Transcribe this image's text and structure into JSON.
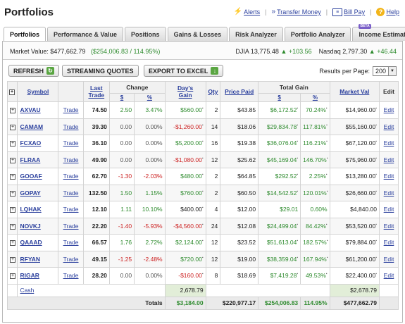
{
  "page_title": "Portfolios",
  "top_links": {
    "alerts": "Alerts",
    "transfer": "Transfer Money",
    "billpay": "Bill Pay",
    "help": "Help"
  },
  "tabs": [
    {
      "label": "Portfolios",
      "active": true
    },
    {
      "label": "Performance & Value",
      "active": false
    },
    {
      "label": "Positions",
      "active": false
    },
    {
      "label": "Gains & Losses",
      "active": false
    },
    {
      "label": "Risk Analyzer",
      "active": false
    },
    {
      "label": "Portfolio Analyzer",
      "active": false
    },
    {
      "label": "Income Estimator",
      "active": false,
      "badge": "BETA"
    }
  ],
  "summary": {
    "market_value_label": "Market Value:",
    "market_value": "$477,662.79",
    "gain_text": "($254,006.83 / 114.95%)",
    "djia_label": "DJIA",
    "djia_value": "13,775.48",
    "djia_change": "+103.56",
    "nasdaq_label": "Nasdaq",
    "nasdaq_value": "2,797.30",
    "nasdaq_change": "+46.44"
  },
  "toolbar": {
    "refresh": "REFRESH",
    "streaming": "STREAMING QUOTES",
    "export": "EXPORT TO EXCEL",
    "results_label": "Results per Page:",
    "results_value": "200"
  },
  "columns": {
    "symbol": "Symbol",
    "last_trade_1": "Last",
    "last_trade_2": "Trade",
    "change": "Change",
    "change_dollar": "$",
    "change_pct": "%",
    "days_gain_1": "Day's",
    "days_gain_2": "Gain",
    "qty": "Qty",
    "price_paid": "Price Paid",
    "total_gain": "Total Gain",
    "tg_dollar": "$",
    "tg_pct": "%",
    "market_val": "Market Val",
    "edit": "Edit"
  },
  "rows": [
    {
      "symbol": "AXVAU",
      "trade": "Trade",
      "last": "74.50",
      "chg": "2.50",
      "chg_pct": "3.47%",
      "day_gain": "$560.00",
      "qty": "2",
      "paid": "$43.85",
      "tg": "$6,172.52",
      "tg_pct": "70.24%",
      "mval": "$14,960.00",
      "edit": "Edit",
      "dir": "pos",
      "tgdir": "pos"
    },
    {
      "symbol": "CAMAM",
      "trade": "Trade",
      "last": "39.30",
      "chg": "0.00",
      "chg_pct": "0.00%",
      "day_gain": "-$1,260.00",
      "qty": "14",
      "paid": "$18.06",
      "tg": "$29,834.78",
      "tg_pct": "117.81%",
      "mval": "$55,160.00",
      "edit": "Edit",
      "dir": "flat",
      "dgdir": "neg",
      "tgdir": "pos"
    },
    {
      "symbol": "FCXAO",
      "trade": "Trade",
      "last": "36.10",
      "chg": "0.00",
      "chg_pct": "0.00%",
      "day_gain": "$5,200.00",
      "qty": "16",
      "paid": "$19.38",
      "tg": "$36,076.04",
      "tg_pct": "116.21%",
      "mval": "$67,120.00",
      "edit": "Edit",
      "dir": "flat",
      "dgdir": "pos",
      "tgdir": "pos"
    },
    {
      "symbol": "FLRAA",
      "trade": "Trade",
      "last": "49.90",
      "chg": "0.00",
      "chg_pct": "0.00%",
      "day_gain": "-$1,080.00",
      "qty": "12",
      "paid": "$25.62",
      "tg": "$45,169.04",
      "tg_pct": "146.70%",
      "mval": "$75,960.00",
      "edit": "Edit",
      "dir": "flat",
      "dgdir": "neg",
      "tgdir": "pos"
    },
    {
      "symbol": "GOOAF",
      "trade": "Trade",
      "last": "62.70",
      "chg": "-1.30",
      "chg_pct": "-2.03%",
      "day_gain": "$480.00",
      "qty": "2",
      "paid": "$64.85",
      "tg": "$292.52",
      "tg_pct": "2.25%",
      "mval": "$13,280.00",
      "edit": "Edit",
      "dir": "neg",
      "dgdir": "pos",
      "tgdir": "pos"
    },
    {
      "symbol": "GOPAY",
      "trade": "Trade",
      "last": "132.50",
      "chg": "1.50",
      "chg_pct": "1.15%",
      "day_gain": "$760.00",
      "qty": "2",
      "paid": "$60.50",
      "tg": "$14,542.52",
      "tg_pct": "120.01%",
      "mval": "$26,660.00",
      "edit": "Edit",
      "dir": "pos",
      "dgdir": "pos",
      "tgdir": "pos"
    },
    {
      "symbol": "LQHAK",
      "trade": "Trade",
      "last": "12.10",
      "chg": "1.11",
      "chg_pct": "10.10%",
      "day_gain": "$400.00",
      "qty": "4",
      "paid": "$12.00",
      "tg": "$29.01",
      "tg_pct": "0.60%",
      "mval": "$4,840.00",
      "edit": "Edit",
      "dir": "pos",
      "dgdir": "pos",
      "tgdir": "pos"
    },
    {
      "symbol": "NOVKJ",
      "trade": "Trade",
      "last": "22.20",
      "chg": "-1.40",
      "chg_pct": "-5.93%",
      "day_gain": "-$4,560.00",
      "qty": "24",
      "paid": "$12.08",
      "tg": "$24,499.04",
      "tg_pct": "84.42%",
      "mval": "$53,520.00",
      "edit": "Edit",
      "dir": "neg",
      "dgdir": "neg",
      "tgdir": "pos"
    },
    {
      "symbol": "QAAAD",
      "trade": "Trade",
      "last": "66.57",
      "chg": "1.76",
      "chg_pct": "2.72%",
      "day_gain": "$2,124.00",
      "qty": "12",
      "paid": "$23.52",
      "tg": "$51,613.04",
      "tg_pct": "182.57%",
      "mval": "$79,884.00",
      "edit": "Edit",
      "dir": "pos",
      "dgdir": "pos",
      "tgdir": "pos"
    },
    {
      "symbol": "RFYAN",
      "trade": "Trade",
      "last": "49.15",
      "chg": "-1.25",
      "chg_pct": "-2.48%",
      "day_gain": "$720.00",
      "qty": "12",
      "paid": "$19.00",
      "tg": "$38,359.04",
      "tg_pct": "167.94%",
      "mval": "$61,200.00",
      "edit": "Edit",
      "dir": "neg",
      "dgdir": "pos",
      "tgdir": "pos"
    },
    {
      "symbol": "RIGAR",
      "trade": "Trade",
      "last": "28.20",
      "chg": "0.00",
      "chg_pct": "0.00%",
      "day_gain": "-$160.00",
      "qty": "8",
      "paid": "$18.69",
      "tg": "$7,419.28",
      "tg_pct": "49.53%",
      "mval": "$22,400.00",
      "edit": "Edit",
      "dir": "flat",
      "dgdir": "neg",
      "tgdir": "pos"
    }
  ],
  "cash": {
    "label": "Cash",
    "days_gain": "2,678.79",
    "mval": "$2,678.79"
  },
  "totals": {
    "label": "Totals",
    "days_gain": "$3,184.00",
    "paid": "$220,977.17",
    "tg": "$254,006.83",
    "tg_pct": "114.95%",
    "mval": "$477,662.79"
  },
  "colors": {
    "positive": "#2e8b2e",
    "negative": "#cc2222",
    "link": "#2a3f9d"
  }
}
